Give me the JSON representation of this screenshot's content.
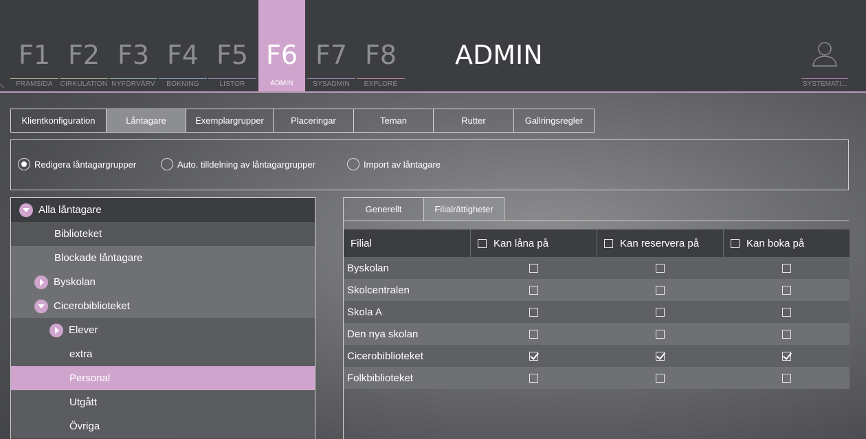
{
  "fkeys": [
    {
      "num": "F1",
      "label": "FRAMSIDA",
      "accent": "#b7b58a"
    },
    {
      "num": "F2",
      "label": "CIRKULATION",
      "accent": "#b7b58a"
    },
    {
      "num": "F3",
      "label": "NYFÖRVÄRV",
      "accent": "#8ab39a"
    },
    {
      "num": "F4",
      "label": "BOKNING",
      "accent": "#8aa3b8"
    },
    {
      "num": "F5",
      "label": "LISTOR",
      "accent": "#a08aa9"
    },
    {
      "num": "F6",
      "label": "ADMIN",
      "accent": "#cfa5cd"
    },
    {
      "num": "F7",
      "label": "SYSADMIN",
      "accent": "#9a8ab8"
    },
    {
      "num": "F8",
      "label": "EXPLORE",
      "accent": "#c48a9a"
    }
  ],
  "header": {
    "title": "ADMIN",
    "user_label": "SYSTEMATI..."
  },
  "tabs": [
    "Klientkonfiguration",
    "Låntagare",
    "Exemplargrupper",
    "Placeringar",
    "Teman",
    "Rutter",
    "Gallringsregler"
  ],
  "radios": [
    {
      "label": "Redigera låntagargrupper",
      "selected": true
    },
    {
      "label": "Auto. tilldelning av låntagargrupper",
      "selected": false
    },
    {
      "label": "Import av låntagare",
      "selected": false
    }
  ],
  "tree": [
    {
      "label": "Alla låntagare",
      "level": 0,
      "toggle": "down",
      "style": "root"
    },
    {
      "label": "Biblioteket",
      "level": 1,
      "toggle": "none",
      "style": "band"
    },
    {
      "label": "Blockade låntagare",
      "level": 1,
      "toggle": "none",
      "style": "plain"
    },
    {
      "label": "Byskolan",
      "level": 1,
      "toggle": "right",
      "style": "plain"
    },
    {
      "label": "Cicerobiblioteket",
      "level": 1,
      "toggle": "down",
      "style": "plain"
    },
    {
      "label": "Elever",
      "level": 2,
      "toggle": "right",
      "style": "sub"
    },
    {
      "label": "extra",
      "level": 2,
      "toggle": "none",
      "style": "sub"
    },
    {
      "label": "Personal",
      "level": 2,
      "toggle": "none",
      "style": "selected"
    },
    {
      "label": "Utgått",
      "level": 2,
      "toggle": "none",
      "style": "sub"
    },
    {
      "label": "Övriga",
      "level": 2,
      "toggle": "none",
      "style": "sub"
    }
  ],
  "subtabs": [
    "Generellt",
    "Filialrättigheter"
  ],
  "grid": {
    "headers": [
      "Filial",
      "Kan låna på",
      "Kan reservera på",
      "Kan boka på"
    ],
    "rows": [
      {
        "name": "Byskolan",
        "checks": [
          false,
          false,
          false
        ]
      },
      {
        "name": "Skolcentralen",
        "checks": [
          false,
          false,
          false
        ]
      },
      {
        "name": "Skola A",
        "checks": [
          false,
          false,
          false
        ]
      },
      {
        "name": "Den nya skolan",
        "checks": [
          false,
          false,
          false
        ]
      },
      {
        "name": "Cicerobiblioteket",
        "checks": [
          true,
          true,
          true
        ]
      },
      {
        "name": "Folkbiblioteket",
        "checks": [
          false,
          false,
          false
        ]
      }
    ]
  }
}
